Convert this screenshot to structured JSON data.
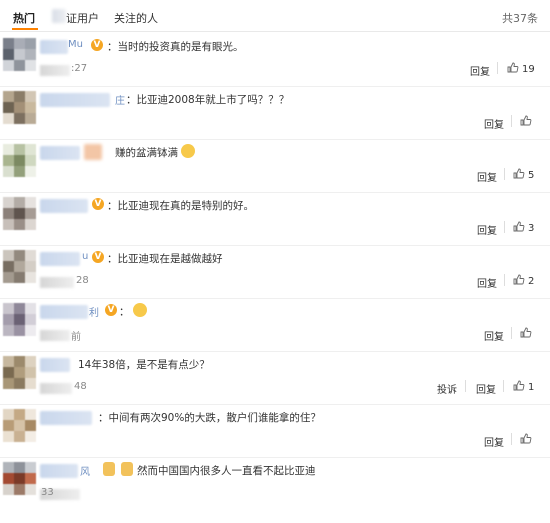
{
  "tabs": {
    "hot_label": "热门",
    "verified_label": "证用户",
    "following_label": "关注的人",
    "total_count": "共37条"
  },
  "comments": [
    {
      "username_visible": "Mu",
      "text": "：当时的投资真的是有眼光。",
      "time_visible": ":27",
      "reply_label": "回复",
      "like_count": "19"
    },
    {
      "username_visible": "庄",
      "text": "：比亚迪2008年就上市了吗？？？",
      "reply_label": "回复",
      "like_count": ""
    },
    {
      "text": "赚的盆满钵满",
      "reply_label": "回复",
      "like_count": "5"
    },
    {
      "text": "：比亚迪现在真的是特别的好。",
      "reply_label": "回复",
      "like_count": "3"
    },
    {
      "username_visible": "u",
      "text": "：比亚迪现在是越做越好",
      "time_visible": "28",
      "reply_label": "回复",
      "like_count": "2"
    },
    {
      "username_visible": "利",
      "text": "：",
      "time_visible": "前",
      "reply_label": "回复",
      "like_count": ""
    },
    {
      "text": "14年38倍，是不是有点少？",
      "time_visible": "48",
      "report_label": "投诉",
      "reply_label": "回复",
      "like_count": "1"
    },
    {
      "text": "：中间有两次90%的大跌，散户们谁能拿的住？",
      "reply_label": "回复",
      "like_count": ""
    },
    {
      "username_visible": "风",
      "text": "然而中国国内很多人一直看不起比亚迪",
      "time_visible": "33",
      "reply_label": "",
      "like_count": ""
    }
  ]
}
